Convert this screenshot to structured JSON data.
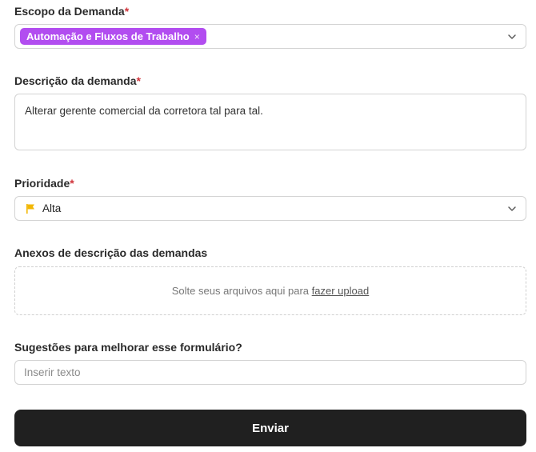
{
  "escopo": {
    "label": "Escopo da Demanda",
    "required_mark": "*",
    "selected_tag": "Automação e Fluxos de Trabalho",
    "remove_symbol": "×",
    "tag_color": "#b24df0",
    "dropdown_icon": "chevron-down-icon"
  },
  "descricao": {
    "label": "Descrição da demanda",
    "required_mark": "*",
    "value": "Alterar gerente comercial da corretora tal para tal."
  },
  "prioridade": {
    "label": "Prioridade",
    "required_mark": "*",
    "value": "Alta",
    "icon": "flag-icon",
    "icon_color": "#f2b705",
    "dropdown_icon": "chevron-down-icon"
  },
  "anexos": {
    "label": "Anexos de descrição das demandas",
    "drop_text": "Solte seus arquivos aqui para",
    "upload_link": "fazer upload"
  },
  "sugestoes": {
    "label": "Sugestões para melhorar esse formulário?",
    "placeholder": "Inserir texto",
    "value": ""
  },
  "submit": {
    "label": "Enviar",
    "color": "#202020"
  },
  "colors": {
    "required": "#d0343b"
  }
}
